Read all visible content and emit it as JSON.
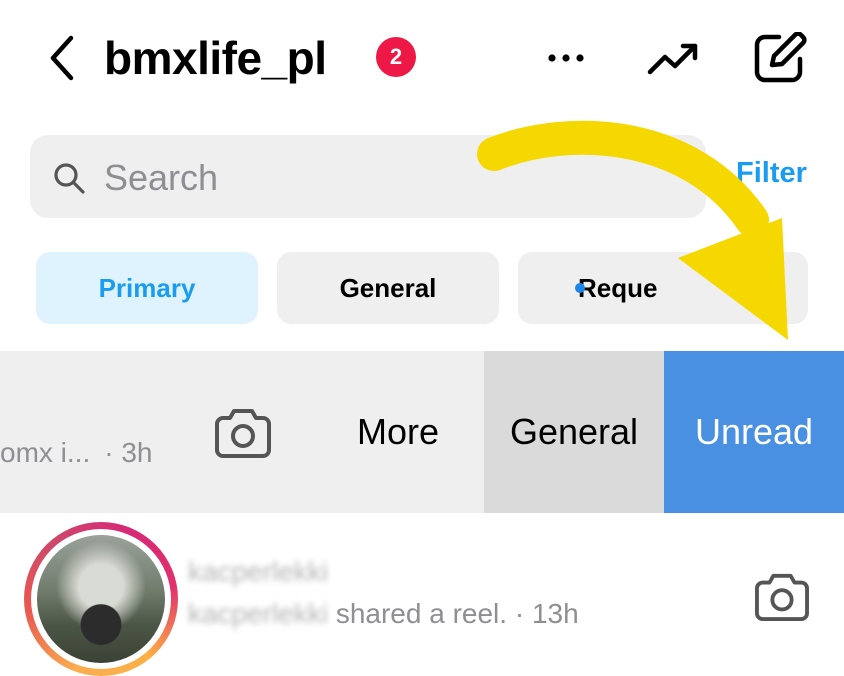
{
  "header": {
    "title": "bmxlife_pl",
    "badge_count": "2"
  },
  "search": {
    "placeholder": "Search",
    "filter_label": "Filter"
  },
  "tabs": [
    {
      "label": "Primary",
      "selected": true
    },
    {
      "label": "General",
      "selected": false
    },
    {
      "label": "Reque",
      "selected": false,
      "has_dot": true
    }
  ],
  "rows": [
    {
      "preview": "omx i...",
      "time": "· 3h",
      "actions": {
        "more": "More",
        "general": "General",
        "unread": "Unread"
      },
      "unread_color": "#4a90e2"
    },
    {
      "name": "kacperlekki",
      "sender": "kacperlekki",
      "message": " shared a reel.",
      "time": " · 13h"
    }
  ],
  "colors": {
    "accent": "#1a9cf0",
    "badge": "#ed1845",
    "arrow": "#f5d800"
  },
  "icons": [
    "back-chevron-icon",
    "more-dots-icon",
    "trending-icon",
    "compose-icon",
    "search-icon",
    "camera-icon"
  ]
}
